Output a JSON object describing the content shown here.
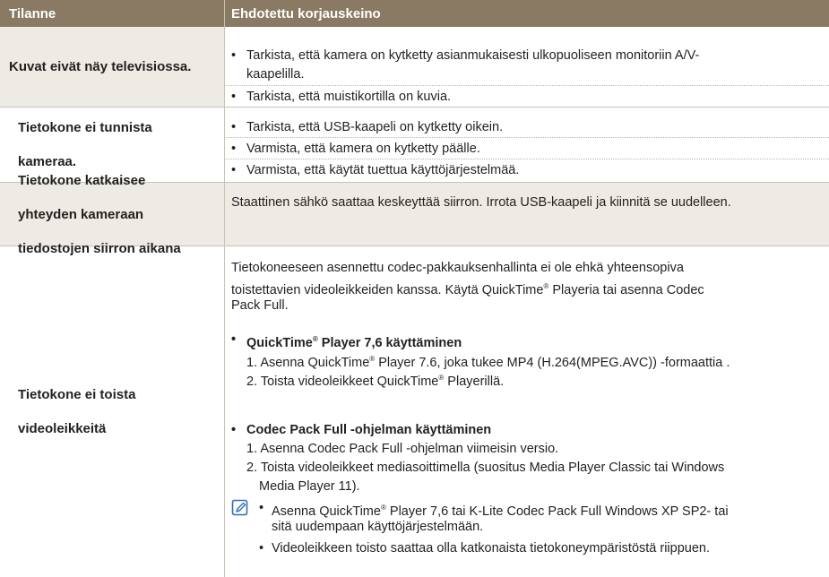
{
  "header": {
    "col1": "Tilanne",
    "col2": "Ehdotettu korjauskeino"
  },
  "bullet": "•",
  "rows": [
    {
      "situation": "Kuvat eivät näy televisiossa.",
      "items": [
        {
          "l1": "Tarkista, että kamera on kytketty asianmukaisesti ulkopuoliseen monitoriin A/V-",
          "l2": "kaapelilla."
        },
        {
          "l1": "Tarkista, että muistikortilla on kuvia."
        }
      ]
    },
    {
      "situation_l1": "Tietokone ei tunnista",
      "situation_l2": "kameraa.",
      "items": [
        {
          "l1": "Tarkista, että USB-kaapeli on kytketty oikein."
        },
        {
          "l1": "Varmista, että kamera on kytketty päälle."
        },
        {
          "l1": "Varmista, että käytät tuettua käyttöjärjestelmää."
        }
      ]
    },
    {
      "situation_l1": "Tietokone katkaisee",
      "situation_l2": "yhteyden kameraan",
      "situation_l3": "tiedostojen siirron aikana",
      "text": "Staattinen sähkö saattaa keskeyttää siirron. Irrota USB-kaapeli ja kiinnitä se uudelleen."
    },
    {
      "situation_l1": "Tietokone ei toista",
      "situation_l2": "videoleikkeitä",
      "intro_l1": "Tietokoneeseen asennettu codec-pakkauksenhallinta ei ole ehkä yhteensopiva",
      "intro_l2a": "toistettavien videoleikkeiden kanssa. Käytä QuickTime",
      "intro_l2b": " Playeria tai asenna Codec",
      "intro_l3": "Pack Full.",
      "reg": "®",
      "qt_title_a": "QuickTime",
      "qt_title_b": " Player 7,6 käyttäminen",
      "qt_step1a": "1. Asenna QuickTime",
      "qt_step1b": " Player 7.6, joka tukee MP4 (H.264(MPEG.AVC)) -formaattia .",
      "qt_step2a": "2. Toista videoleikkeet QuickTime",
      "qt_step2b": " Playerillä.",
      "codec_title": "Codec Pack Full -ohjelman käyttäminen",
      "codec_step1": "1. Asenna Codec Pack Full -ohjelman viimeisin versio.",
      "codec_step2_l1": "2. Toista videoleikkeet mediasoittimella (suositus Media Player Classic tai Windows",
      "codec_step2_l2": "Media Player 11).",
      "note1_a": "Asenna QuickTime",
      "note1_b": " Player 7,6 tai K-Lite Codec Pack Full Windows XP SP2- tai",
      "note1_l2": "sitä uudempaan käyttöjärjestelmään.",
      "note2": "Videoleikkeen toisto saattaa olla katkonaista tietokoneympäristöstä riippuen."
    }
  ],
  "colors": {
    "header_bg": "#8a7a63",
    "shade_bg": "#eeebe4",
    "border": "#c9c3b8",
    "note_icon": "#2e6fb5"
  }
}
